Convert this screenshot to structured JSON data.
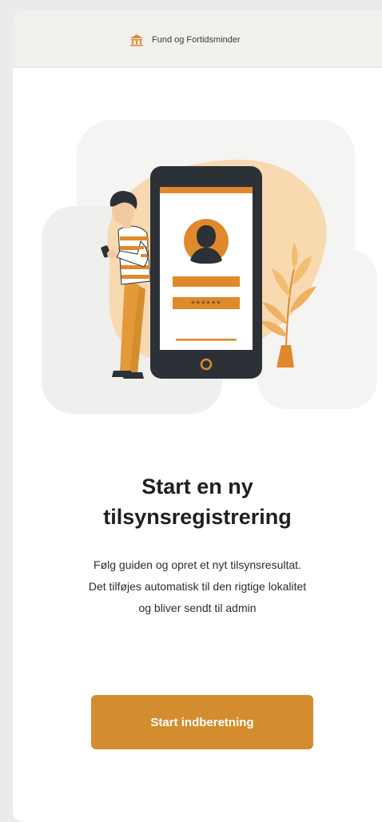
{
  "header": {
    "title": "Fund og Fortidsminder",
    "icon": "museum-icon"
  },
  "illustration": {
    "icon": "phone-login-illustration",
    "password_mask": "******"
  },
  "main": {
    "title_line1": "Start en ny",
    "title_line2": "tilsynsregistrering",
    "description_line1": "Følg guiden og opret et nyt tilsynsresultat.",
    "description_line2": "Det tilføjes automatisk til den rigtige lokalitet",
    "description_line3": "og bliver sendt til admin"
  },
  "cta": {
    "label": "Start indberetning"
  },
  "colors": {
    "accent": "#d48d2e",
    "phone": "#2b3136",
    "header_bg": "#f1f0ed"
  }
}
